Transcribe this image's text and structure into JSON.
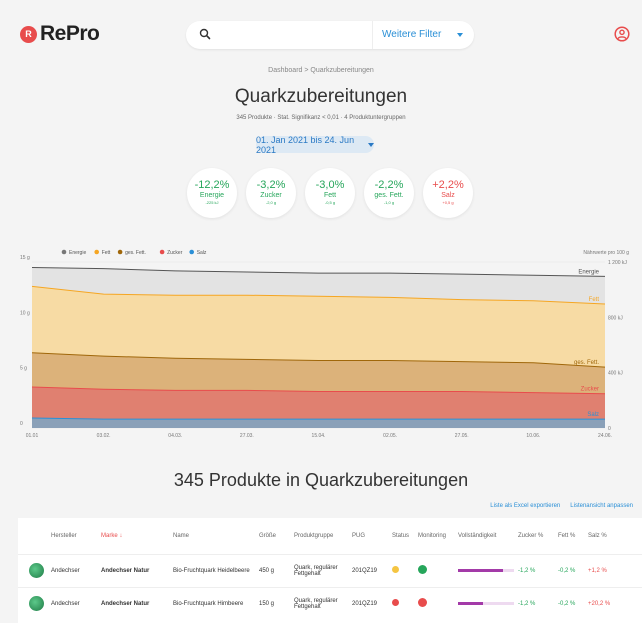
{
  "header": {
    "logo_badge": "R",
    "logo_text": "RePro",
    "search_placeholder": "",
    "filter_label": "Weitere Filter"
  },
  "breadcrumb": "Dashboard  >  Quarkzubereitungen",
  "page_title": "Quarkzubereitungen",
  "subtitle": "345 Produkte · Stat. Signifikanz < 0,01 · 4 Produktuntergruppen",
  "date_range": "01. Jan 2021 bis 24. Jun 2021",
  "kpis": [
    {
      "value": "-12,2%",
      "label": "Energie",
      "sub": "-225 kJ",
      "trend": "neg"
    },
    {
      "value": "-3,2%",
      "label": "Zucker",
      "sub": "-2,0 g",
      "trend": "neg"
    },
    {
      "value": "-3,0%",
      "label": "Fett",
      "sub": "-0,5 g",
      "trend": "neg"
    },
    {
      "value": "-2,2%",
      "label": "ges. Fett.",
      "sub": "-1,0 g",
      "trend": "neg"
    },
    {
      "value": "+2,2%",
      "label": "Salz",
      "sub": "+0,5 g",
      "trend": "pos"
    }
  ],
  "chart_data": {
    "type": "area",
    "legend": [
      {
        "name": "Energie",
        "color": "#777777"
      },
      {
        "name": "Fett",
        "color": "#f5a623"
      },
      {
        "name": "ges. Fett.",
        "color": "#a0670a"
      },
      {
        "name": "Zucker",
        "color": "#e84c4c"
      },
      {
        "name": "Salz",
        "color": "#2a8fd6"
      }
    ],
    "right_axis_title": "Nährwerte pro 100 g",
    "categories": [
      "01.01",
      "03.02.",
      "04.03.",
      "27.03.",
      "15.04.",
      "02.05.",
      "27.05.",
      "10.06.",
      "24.06."
    ],
    "y_ticks_left": [
      "15 g",
      "10 g",
      "5 g",
      "0"
    ],
    "y_ticks_right": [
      "1 200 kJ",
      "800 kJ",
      "400 kJ",
      "0"
    ],
    "ylim": [
      0,
      15
    ],
    "series": [
      {
        "name": "Energie",
        "color": "#e3e3e3",
        "line": "#555555",
        "values": [
          14.5,
          14.4,
          14.2,
          14.1,
          14.0,
          14.0,
          13.9,
          13.8,
          13.7
        ]
      },
      {
        "name": "Fett",
        "color": "#f7dba4",
        "line": "#f5a623",
        "values": [
          12.8,
          12.1,
          12.0,
          12.0,
          11.9,
          11.8,
          11.6,
          11.5,
          11.2
        ]
      },
      {
        "name": "ges. Fett.",
        "color": "#dcb27a",
        "line": "#a0670a",
        "values": [
          6.8,
          6.5,
          6.3,
          6.2,
          6.1,
          6.1,
          6.0,
          5.9,
          5.5
        ]
      },
      {
        "name": "Zucker",
        "color": "#e08070",
        "line": "#e84c4c",
        "values": [
          3.7,
          3.5,
          3.4,
          3.4,
          3.3,
          3.3,
          3.3,
          3.2,
          3.1
        ]
      },
      {
        "name": "Salz",
        "color": "#8aa0b8",
        "line": "#2a8fd6",
        "values": [
          0.9,
          0.8,
          0.8,
          0.8,
          0.8,
          0.8,
          0.8,
          0.8,
          0.8
        ]
      }
    ],
    "end_labels": [
      {
        "name": "Energie",
        "value": 13.7,
        "color": "#555555"
      },
      {
        "name": "Fett",
        "value": 11.2,
        "color": "#f5a623"
      },
      {
        "name": "ges. Fett.",
        "value": 5.5,
        "color": "#a0670a"
      },
      {
        "name": "Zucker",
        "value": 3.1,
        "color": "#e84c4c"
      },
      {
        "name": "Salz",
        "value": 0.8,
        "color": "#2a8fd6"
      }
    ]
  },
  "section_title": "345 Produkte in Quarkzubereitungen",
  "table_actions": {
    "export": "Liste als Excel exportieren",
    "customize": "Listenansicht anpassen"
  },
  "table": {
    "headers": [
      "",
      "Hersteller",
      "Marke ↓",
      "Name",
      "Größe",
      "Produktgruppe",
      "PUG",
      "Status",
      "Monitoring",
      "Vollständigkeit",
      "Zucker %",
      "Fett %",
      "Salz %"
    ],
    "rows": [
      {
        "hersteller": "Andechser",
        "marke": "Andechser Natur",
        "name": "Bio-Fruchtquark Heidelbeere",
        "groesse": "450 g",
        "gruppe": "Quark, regulärer Fettgehalt",
        "pug": "201QZ19",
        "status_color": "#f5c542",
        "monitoring_color": "#26a65b",
        "completeness": 0.8,
        "zucker": "-1,2 %",
        "fett": "-0,2 %",
        "salz": "+1,2 %"
      },
      {
        "hersteller": "Andechser",
        "marke": "Andechser Natur",
        "name": "Bio-Fruchtquark Himbeere",
        "groesse": "150 g",
        "gruppe": "Quark, regulärer Fettgehalt",
        "pug": "201QZ19",
        "status_color": "#e84c4c",
        "monitoring_color": "#e84c4c",
        "completeness": 0.45,
        "zucker": "-1,2 %",
        "fett": "-0,2 %",
        "salz": "+20,2 %"
      }
    ]
  }
}
